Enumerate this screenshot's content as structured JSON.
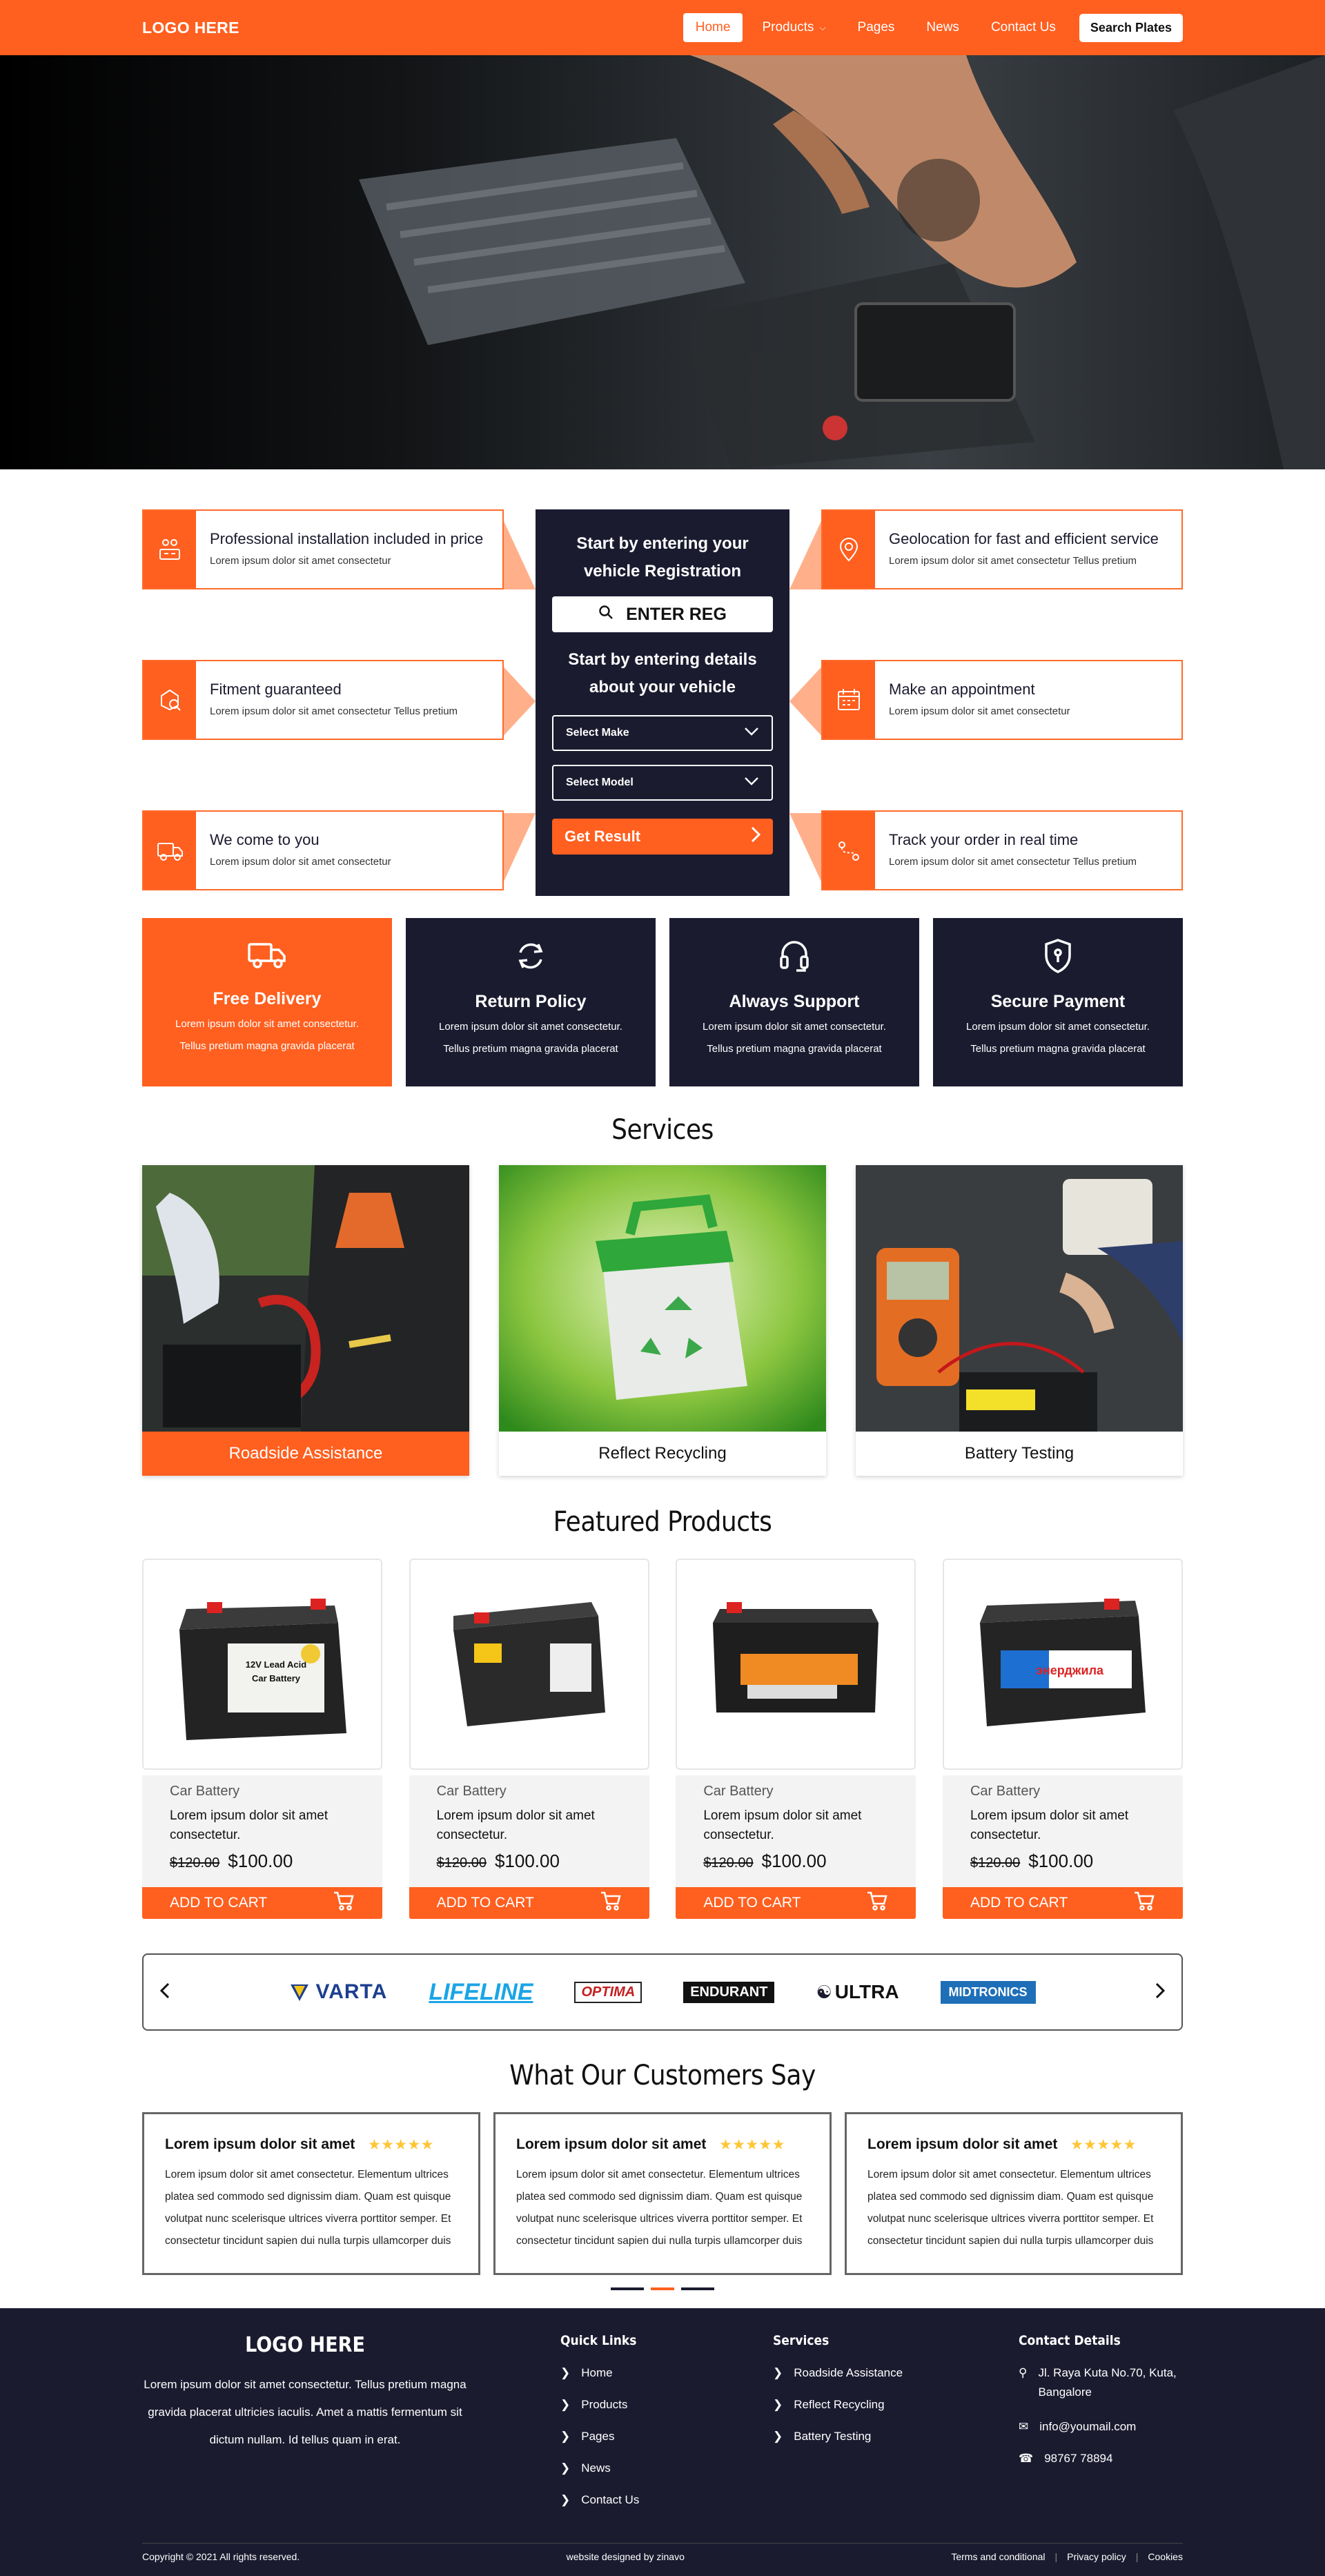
{
  "header": {
    "logo": "LOGO HERE",
    "nav": [
      "Home",
      "Products",
      "Pages",
      "News",
      "Contact Us"
    ],
    "search_button": "Search Plates"
  },
  "features": [
    {
      "title": "Professional installation included in price",
      "desc": "Lorem ipsum dolor sit amet consectetur",
      "icon": "installation-icon"
    },
    {
      "title": "Fitment guaranteed",
      "desc": "Lorem ipsum dolor sit amet consectetur Tellus pretium",
      "icon": "fitment-icon"
    },
    {
      "title": "We come to you",
      "desc": "Lorem ipsum dolor sit amet consectetur",
      "icon": "van-icon"
    },
    {
      "title": "Geolocation for fast and efficient service",
      "desc": "Lorem ipsum dolor sit amet consectetur Tellus pretium",
      "icon": "location-pin-icon"
    },
    {
      "title": "Make an appointment",
      "desc": "Lorem ipsum dolor sit amet consectetur",
      "icon": "calendar-icon"
    },
    {
      "title": "Track your order in real time",
      "desc": "Lorem ipsum dolor sit amet consectetur Tellus pretium",
      "icon": "track-route-icon"
    }
  ],
  "finder": {
    "heading1": "Start by entering your vehicle Registration",
    "reg_label": "ENTER REG",
    "heading2": "Start by entering details about your vehicle",
    "select_make": "Select Make",
    "select_model": "Select Model",
    "result_button": "Get Result"
  },
  "tiles": [
    {
      "title": "Free Delivery",
      "line1": "Lorem ipsum dolor sit amet consectetur.",
      "line2": "Tellus pretium magna gravida placerat",
      "icon": "truck-icon"
    },
    {
      "title": "Return Policy",
      "line1": "Lorem ipsum dolor sit amet consectetur.",
      "line2": "Tellus pretium magna gravida placerat",
      "icon": "refresh-icon"
    },
    {
      "title": "Always Support",
      "line1": "Lorem ipsum dolor sit amet consectetur.",
      "line2": "Tellus pretium magna gravida placerat",
      "icon": "headset-icon"
    },
    {
      "title": "Secure Payment",
      "line1": "Lorem ipsum dolor sit amet consectetur.",
      "line2": "Tellus pretium magna gravida placerat",
      "icon": "shield-icon"
    }
  ],
  "services": {
    "title": "Services",
    "items": [
      "Roadside Assistance",
      "Reflect Recycling",
      "Battery Testing"
    ]
  },
  "products": {
    "title": "Featured Products",
    "items": [
      {
        "category": "Car Battery",
        "name": "Lorem ipsum dolor sit amet consectetur.",
        "old_price": "$120.00",
        "price": "$100.00",
        "cart": "ADD TO CART"
      },
      {
        "category": "Car Battery",
        "name": "Lorem ipsum dolor sit amet consectetur.",
        "old_price": "$120.00",
        "price": "$100.00",
        "cart": "ADD TO CART"
      },
      {
        "category": "Car Battery",
        "name": "Lorem ipsum dolor sit amet consectetur.",
        "old_price": "$120.00",
        "price": "$100.00",
        "cart": "ADD TO CART"
      },
      {
        "category": "Car Battery",
        "name": "Lorem ipsum dolor sit amet consectetur.",
        "old_price": "$120.00",
        "price": "$100.00",
        "cart": "ADD TO CART"
      }
    ]
  },
  "brands": [
    "VARTA",
    "LIFELINE",
    "OPTIMA",
    "ENDURANT",
    "ULTRA",
    "MIDTRONICS"
  ],
  "testimonials": {
    "title": "What Our Customers Say",
    "items": [
      {
        "title": "Lorem ipsum dolor sit amet",
        "stars": "★★★★★",
        "body": "Lorem ipsum dolor sit amet consectetur. Elementum ultrices platea sed commodo sed dignissim diam. Quam est quisque volutpat nunc scelerisque ultrices viverra porttitor semper. Et consectetur tincidunt sapien dui nulla turpis ullamcorper duis"
      },
      {
        "title": "Lorem ipsum dolor sit amet",
        "stars": "★★★★★",
        "body": "Lorem ipsum dolor sit amet consectetur. Elementum ultrices platea sed commodo sed dignissim diam. Quam est quisque volutpat nunc scelerisque ultrices viverra porttitor semper. Et consectetur tincidunt sapien dui nulla turpis ullamcorper duis"
      },
      {
        "title": "Lorem ipsum dolor sit amet",
        "stars": "★★★★★",
        "body": "Lorem ipsum dolor sit amet consectetur. Elementum ultrices platea sed commodo sed dignissim diam. Quam est quisque volutpat nunc scelerisque ultrices viverra porttitor semper. Et consectetur tincidunt sapien dui nulla turpis ullamcorper duis"
      }
    ]
  },
  "footer": {
    "logo": "LOGO HERE",
    "desc": "Lorem ipsum dolor sit amet consectetur. Tellus pretium magna gravida placerat ultricies iaculis. Amet a mattis fermentum sit dictum nullam. Id tellus quam in erat.",
    "quick_links_title": "Quick Links",
    "quick_links": [
      "Home",
      "Products",
      "Pages",
      "News",
      "Contact Us"
    ],
    "services_title": "Services",
    "services": [
      "Roadside Assistance",
      "Reflect Recycling",
      "Battery Testing"
    ],
    "contact_title": "Contact Details",
    "address": "Jl. Raya Kuta No.70, Kuta, Bangalore",
    "email": "info@youmail.com",
    "phone": "98767 78894",
    "copyright": "Copyright © 2021 All rights reserved.",
    "designed_by": "website designed by zinavo",
    "bottom_links": [
      "Terms and conditional",
      "Privacy policy",
      "Cookies"
    ]
  },
  "colors": {
    "accent": "#ff5f1f",
    "dark": "#1b1b30",
    "star": "#ffc533"
  }
}
